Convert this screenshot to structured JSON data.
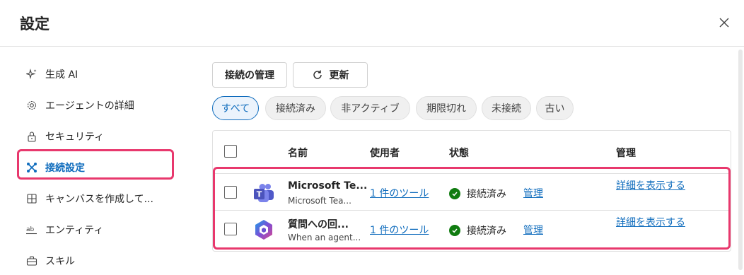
{
  "dialog": {
    "title": "設定"
  },
  "sidebar": {
    "items": [
      {
        "label": "生成 AI",
        "icon": "sparkle-icon"
      },
      {
        "label": "エージェントの詳細",
        "icon": "gear-icon"
      },
      {
        "label": "セキュリティ",
        "icon": "lock-icon"
      },
      {
        "label": "接続設定",
        "icon": "connection-icon",
        "active": true
      },
      {
        "label": "キャンバスを作成して...",
        "icon": "grid-icon"
      },
      {
        "label": "エンティティ",
        "icon": "ab-icon"
      },
      {
        "label": "スキル",
        "icon": "briefcase-icon"
      }
    ]
  },
  "toolbar": {
    "manage_label": "接続の管理",
    "refresh_label": "更新"
  },
  "filters": [
    "すべて",
    "接続済み",
    "非アクティブ",
    "期限切れ",
    "未接続",
    "古い"
  ],
  "table": {
    "headers": {
      "name": "名前",
      "user": "使用者",
      "status": "状態",
      "manage": "管理"
    },
    "rows": [
      {
        "name": "Microsoft Te...",
        "sub": "Microsoft Tea...",
        "user": "1 件のツール",
        "status": "接続済み",
        "manage": "管理",
        "detail": "詳細を表示する",
        "icon": "teams-icon"
      },
      {
        "name": "質問への回...",
        "sub": "When an agent...",
        "user": "1 件のツール",
        "status": "接続済み",
        "manage": "管理",
        "detail": "詳細を表示する",
        "icon": "copilot-icon"
      }
    ]
  },
  "colors": {
    "accent": "#0f6cbd",
    "highlight": "#e8386d",
    "success": "#107c10"
  }
}
